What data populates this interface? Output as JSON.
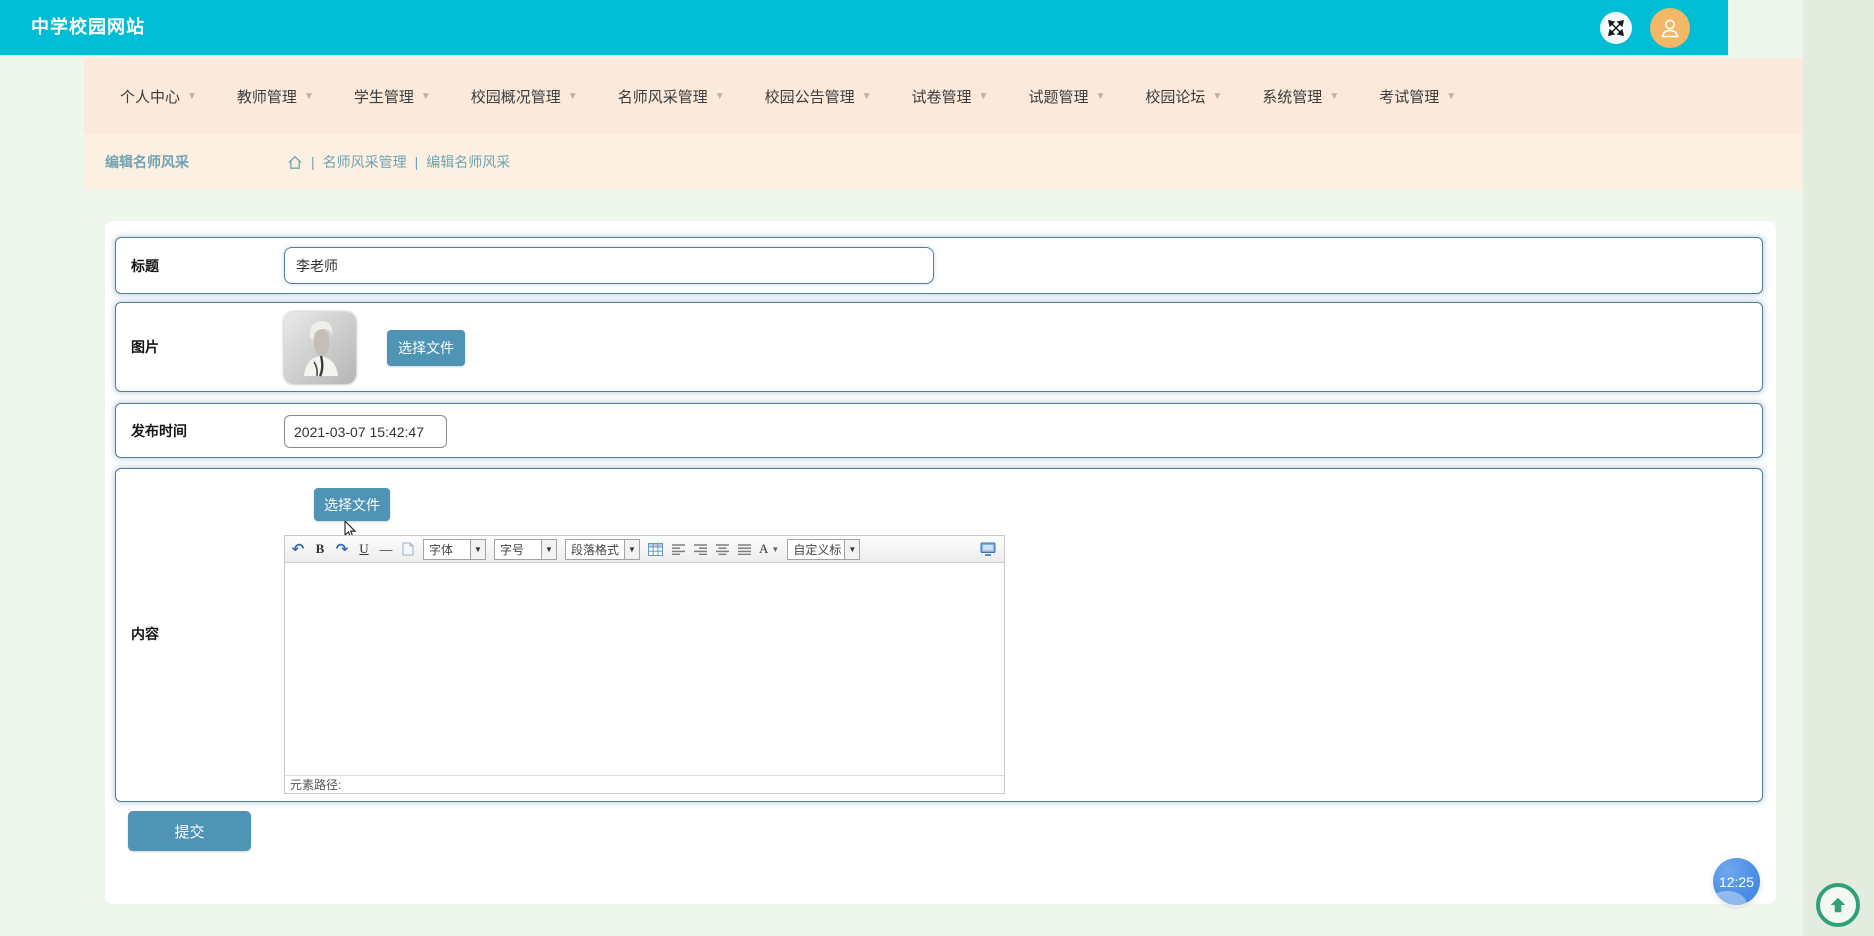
{
  "header": {
    "title": "中学校园网站"
  },
  "nav": {
    "items": [
      "个人中心",
      "教师管理",
      "学生管理",
      "校园概况管理",
      "名师风采管理",
      "校园公告管理",
      "试卷管理",
      "试题管理",
      "校园论坛",
      "系统管理",
      "考试管理"
    ]
  },
  "breadcrumb": {
    "page_title": "编辑名师风采",
    "separator": "|",
    "segments": [
      "名师风采管理",
      "编辑名师风采"
    ]
  },
  "form": {
    "title": {
      "label": "标题",
      "value": "李老师"
    },
    "image": {
      "label": "图片",
      "button": "选择文件"
    },
    "publish_time": {
      "label": "发布时间",
      "value": "2021-03-07 15:42:47"
    },
    "content": {
      "label": "内容",
      "upload_button": "选择文件"
    },
    "submit": "提交"
  },
  "editor": {
    "undo_glyph": "↶",
    "redo_glyph": "↷",
    "bold": "B",
    "underline": "U",
    "dash": "—",
    "color_letter": "A",
    "font_select": "字体",
    "size_select": "字号",
    "paragraph_select": "段落格式",
    "custom_select": "自定义标",
    "status": "元素路径:"
  },
  "widgets": {
    "clock": "12:25"
  },
  "colors": {
    "accent_cyan": "#00bdd6",
    "nav_bg": "#fbeadb",
    "breadcrumb_bg": "#fcf0e2",
    "breadcrumb_text": "#71a3b2",
    "button_blue": "#4f93b5",
    "row_border": "#4e7f9e",
    "avatar_orange": "#f3b765",
    "clock_blue": "#4c8fe6",
    "back_top_green": "#2fa077",
    "page_bg": "#eff6ec"
  }
}
